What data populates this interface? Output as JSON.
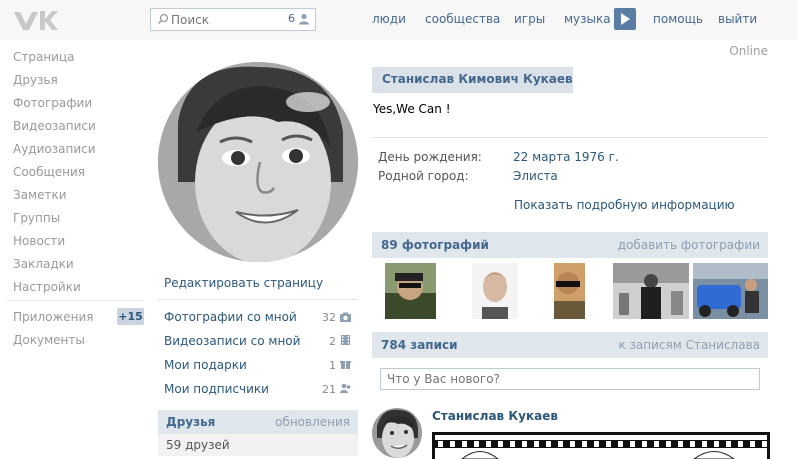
{
  "header": {
    "logo_icon": "vk-logo-icon",
    "search": {
      "placeholder": "Поиск",
      "count": "6"
    },
    "nav": [
      "люди",
      "сообщества",
      "игры",
      "музыка",
      "помощь",
      "выйти"
    ]
  },
  "sidebar": {
    "items": [
      "Страница",
      "Друзья",
      "Фотографии",
      "Видеозаписи",
      "Аудиозаписи",
      "Сообщения",
      "Заметки",
      "Группы",
      "Новости",
      "Закладки",
      "Настройки"
    ],
    "apps_label": "Приложения",
    "apps_badge": "+15",
    "docs_label": "Документы"
  },
  "profile": {
    "edit_label": "Редактировать страницу",
    "links": [
      {
        "label": "Фотографии со мной",
        "count": "32",
        "icon": "camera-icon"
      },
      {
        "label": "Видеозаписи со мной",
        "count": "2",
        "icon": "film-icon"
      },
      {
        "label": "Мои подарки",
        "count": "1",
        "icon": "gift-icon"
      },
      {
        "label": "Мои подписчики",
        "count": "21",
        "icon": "people-icon"
      }
    ],
    "friends": {
      "title": "Друзья",
      "updates": "обновления",
      "count_text": "59 друзей"
    }
  },
  "main": {
    "online": "Online",
    "name": "Станислав Кимович Кукаев",
    "status": "Yes,We Can !",
    "info": [
      {
        "label": "День рождения:",
        "value": "22 марта 1976 г."
      },
      {
        "label": "Родной город:",
        "value": "Элиста"
      }
    ],
    "more_info": "Показать подробную информацию",
    "photos": {
      "title": "89 фотографий",
      "add": "добавить фотографии"
    },
    "wall": {
      "title": "784 записи",
      "link": "к записям Станислава",
      "placeholder": "Что у Вас нового?"
    },
    "post": {
      "author": "Станислав Кукаев"
    }
  },
  "colors": {
    "link": "#2b587a",
    "header_bg": "#f7f7f7",
    "block_bg": "#dfe6ec",
    "accent": "#597da3"
  }
}
